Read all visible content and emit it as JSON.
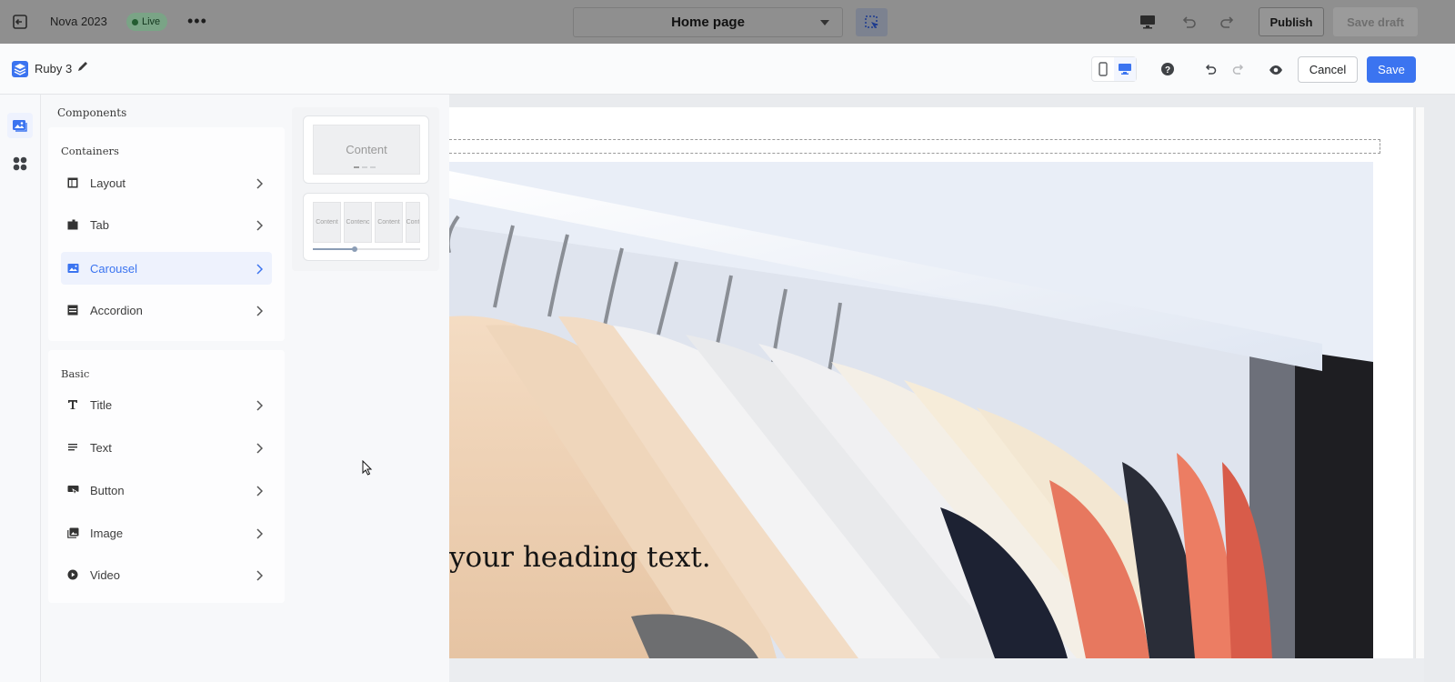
{
  "topbar": {
    "store_name": "Nova 2023",
    "status": "Live",
    "more": "•••",
    "page_selector": "Home page",
    "publish": "Publish",
    "save_draft": "Save draft"
  },
  "editor": {
    "title": "Ruby 3",
    "cancel": "Cancel",
    "save": "Save"
  },
  "panel": {
    "heading": "Components",
    "groups": [
      {
        "title": "Containers",
        "items": [
          {
            "label": "Layout",
            "icon": "layout-icon"
          },
          {
            "label": "Tab",
            "icon": "tab-icon"
          },
          {
            "label": "Carousel",
            "icon": "carousel-icon",
            "active": true
          },
          {
            "label": "Accordion",
            "icon": "accordion-icon"
          }
        ]
      },
      {
        "title": "Basic",
        "items": [
          {
            "label": "Title",
            "icon": "title-icon"
          },
          {
            "label": "Text",
            "icon": "text-icon"
          },
          {
            "label": "Button",
            "icon": "button-icon"
          },
          {
            "label": "Image",
            "icon": "image-icon"
          },
          {
            "label": "Video",
            "icon": "video-icon"
          }
        ]
      }
    ],
    "carousel_previews": {
      "single": {
        "content": "Content"
      },
      "multi": {
        "slides": [
          "Content",
          "Contenc",
          "Content",
          "Cont"
        ]
      }
    }
  },
  "canvas": {
    "heading_text": "your heading text."
  },
  "colors": {
    "accent": "#3b74f0",
    "live_badge": "#7aa486"
  }
}
